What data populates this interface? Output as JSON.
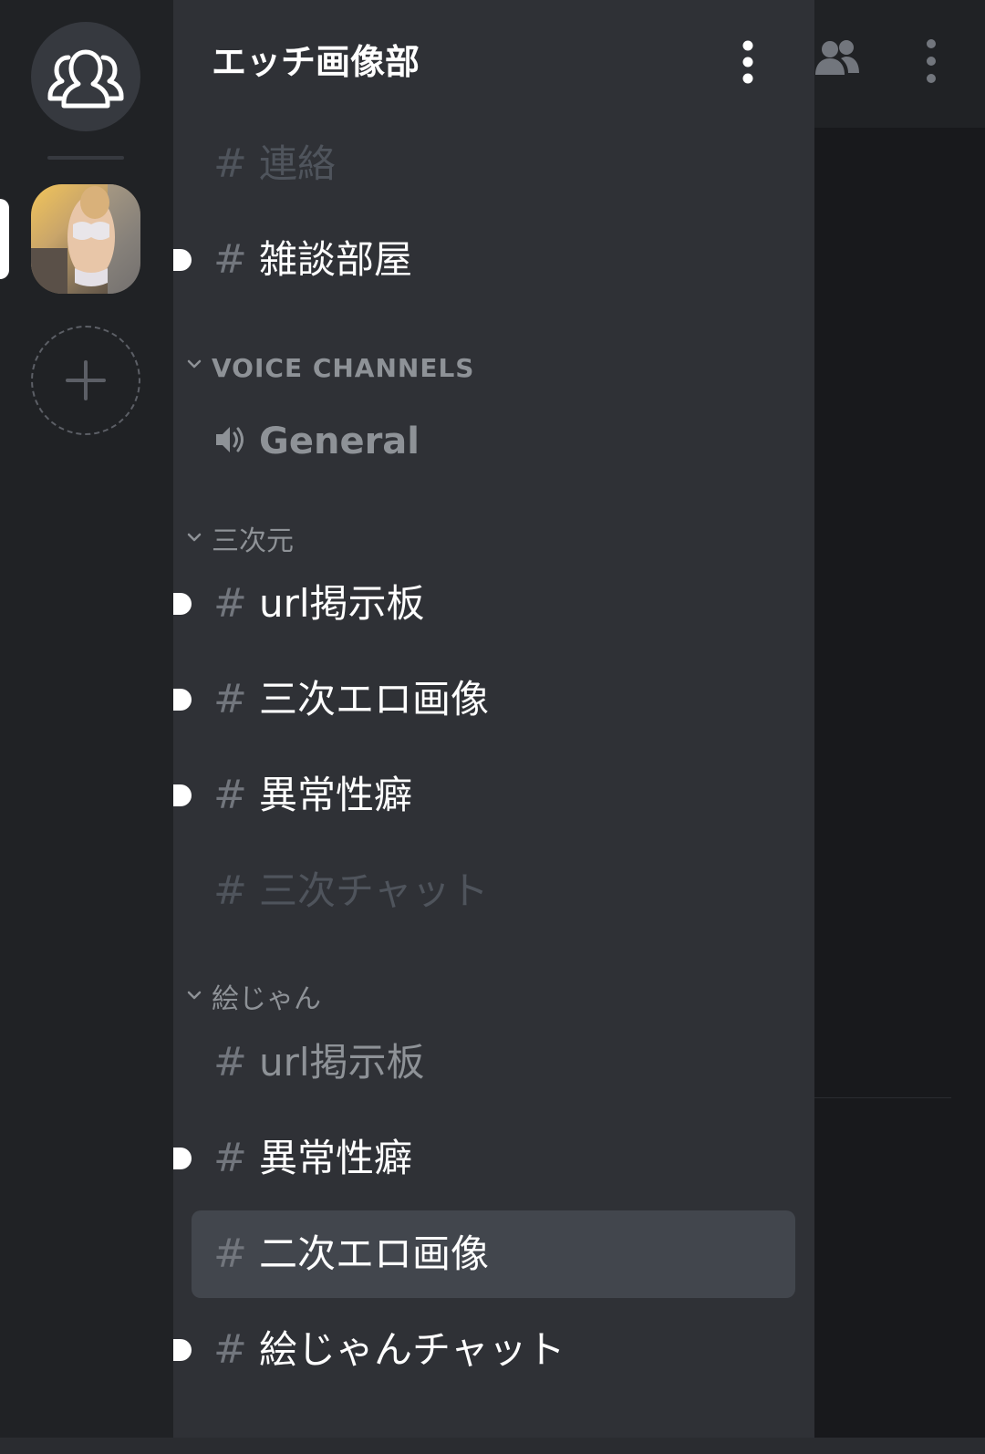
{
  "server_rail": {
    "dm_icon": "friends-icon",
    "add_server_icon": "plus-icon"
  },
  "guild": {
    "name": "エッチ画像部",
    "menu_icon": "more-vertical-icon"
  },
  "channels_top": [
    {
      "name": "連絡",
      "state": "muted"
    },
    {
      "name": "雑談部屋",
      "state": "unread"
    }
  ],
  "voice_category": {
    "label": "VOICE CHANNELS",
    "channels": [
      {
        "name": "General",
        "icon": "speaker-icon"
      }
    ]
  },
  "category_3d": {
    "label": "三次元",
    "channels": [
      {
        "name": "url掲示板",
        "state": "unread"
      },
      {
        "name": "三次エロ画像",
        "state": "unread"
      },
      {
        "name": "異常性癖",
        "state": "unread"
      },
      {
        "name": "三次チャット",
        "state": "muted"
      }
    ]
  },
  "category_art": {
    "label": "絵じゃん",
    "channels": [
      {
        "name": "url掲示板",
        "state": "normal"
      },
      {
        "name": "異常性癖",
        "state": "unread"
      },
      {
        "name": "二次エロ画像",
        "state": "selected"
      },
      {
        "name": "絵じゃんチャット",
        "state": "unread"
      }
    ]
  },
  "header_right": {
    "members_icon": "members-icon",
    "more_icon": "more-vertical-icon"
  },
  "colors": {
    "rail": "#202225",
    "drawer": "#2f3136",
    "selected": "#42464d",
    "unread_text": "#ffffff",
    "normal_text": "#8e9297",
    "muted_text": "#4f545c"
  }
}
